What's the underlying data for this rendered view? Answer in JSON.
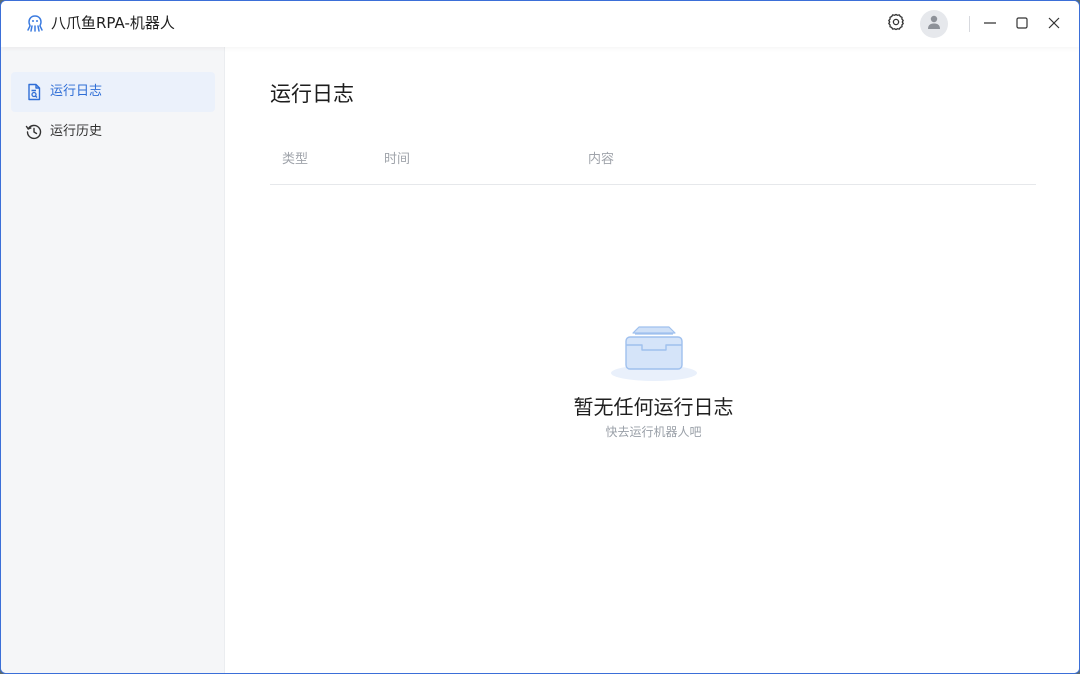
{
  "window": {
    "title": "八爪鱼RPA-机器人",
    "accent_color": "#2f6ed6"
  },
  "titlebar": {
    "icons": [
      "octopus-logo-icon",
      "gear-icon",
      "user-icon",
      "minimize-icon",
      "maximize-icon",
      "close-icon"
    ]
  },
  "sidebar": {
    "items": [
      {
        "label": "运行日志",
        "icon": "log-document-icon",
        "active": true
      },
      {
        "label": "运行历史",
        "icon": "history-clock-icon",
        "active": false
      }
    ]
  },
  "main": {
    "title": "运行日志",
    "table": {
      "columns": [
        "类型",
        "时间",
        "内容"
      ]
    },
    "empty_state": {
      "icon": "empty-inbox-icon",
      "title": "暂无任何运行日志",
      "subtitle": "快去运行机器人吧"
    }
  }
}
